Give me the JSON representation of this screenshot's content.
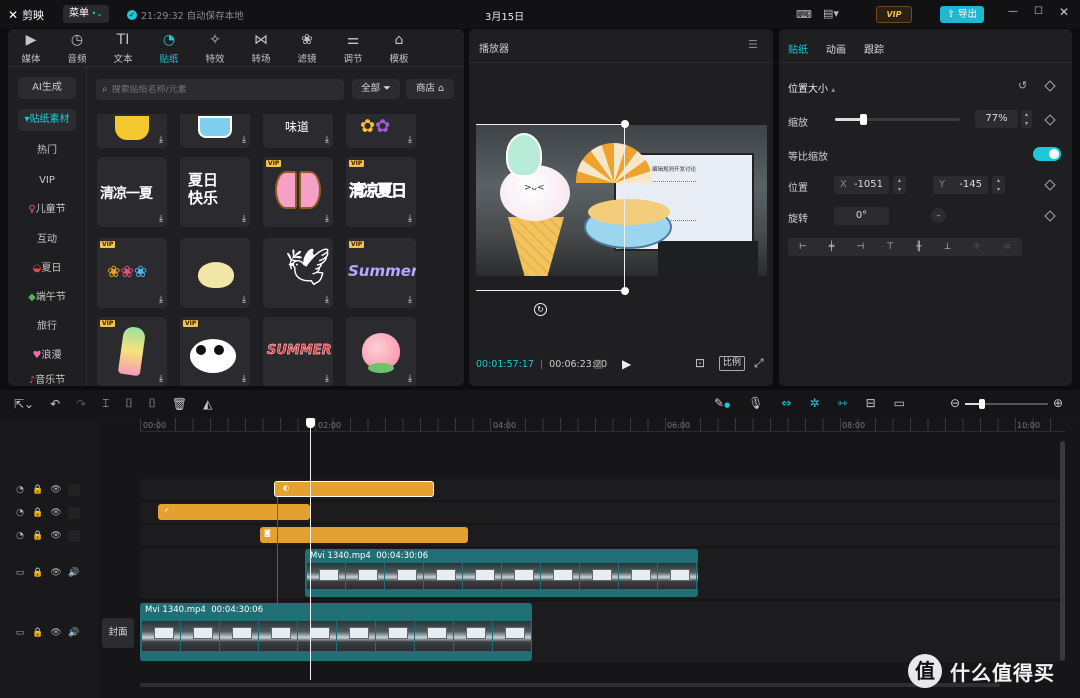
{
  "app": {
    "name": "剪映",
    "menu_label": "菜单",
    "autosave_text": "21:29:32 自动保存本地",
    "project_title": "3月15日",
    "vip_label": "VIP",
    "export_label": "导出"
  },
  "media_tabs": [
    {
      "label": "媒体",
      "icon": "media-icon"
    },
    {
      "label": "音频",
      "icon": "audio-icon"
    },
    {
      "label": "文本",
      "icon": "text-icon"
    },
    {
      "label": "贴纸",
      "icon": "sticker-icon"
    },
    {
      "label": "特效",
      "icon": "effects-icon"
    },
    {
      "label": "转场",
      "icon": "transition-icon"
    },
    {
      "label": "滤镜",
      "icon": "filter-icon"
    },
    {
      "label": "调节",
      "icon": "adjust-icon"
    },
    {
      "label": "模板",
      "icon": "template-icon"
    }
  ],
  "sidebar": {
    "ai_label": "AI生成",
    "active_label": "贴纸素材",
    "items": [
      "热门",
      "VIP",
      "儿童节",
      "互动",
      "夏日",
      "端午节",
      "旅行",
      "浪漫",
      "音乐节"
    ]
  },
  "search": {
    "placeholder": "搜索贴纸名称/元素",
    "filter_label": "全部",
    "store_label": "商店"
  },
  "stickers": [
    {
      "name": "sticker-cup",
      "text": ""
    },
    {
      "name": "sticker-ice",
      "text": ""
    },
    {
      "name": "sticker-weidao",
      "text": "味道"
    },
    {
      "name": "sticker-flowers",
      "text": ""
    },
    {
      "name": "sticker-qingliang-yixia",
      "text": "清凉一夏"
    },
    {
      "name": "sticker-xiari-kuaile",
      "text": "夏日快乐"
    },
    {
      "name": "sticker-butterfly",
      "text": ""
    },
    {
      "name": "sticker-qingliang-xiari",
      "text": "清凉夏日"
    },
    {
      "name": "sticker-tulips",
      "text": ""
    },
    {
      "name": "sticker-bird",
      "text": ""
    },
    {
      "name": "sticker-dove",
      "text": ""
    },
    {
      "name": "sticker-summer",
      "text": "Summer"
    },
    {
      "name": "sticker-popsicle",
      "text": ""
    },
    {
      "name": "sticker-panda",
      "text": ""
    },
    {
      "name": "sticker-summer-red",
      "text": "SUMMER"
    },
    {
      "name": "sticker-peach",
      "text": ""
    }
  ],
  "player": {
    "title": "播放器",
    "current_time": "00:01:57:17",
    "total_time": "00:06:23:20",
    "ratio_label": "比例",
    "slide_text": "编辑规则开发讨论"
  },
  "inspector": {
    "tabs": [
      "贴纸",
      "动画",
      "跟踪"
    ],
    "section_title": "位置大小",
    "scale_label": "缩放",
    "scale_value": "77%",
    "scale_fraction": 0.22,
    "uniform_label": "等比缩放",
    "position_label": "位置",
    "x_label": "X",
    "x_value": "-1051",
    "y_label": "Y",
    "y_value": "-145",
    "rotation_label": "旋转",
    "rotation_value": "0°"
  },
  "timeline": {
    "ruler": [
      "00:00",
      "02:00",
      "04:00",
      "06:00",
      "08:00",
      "10:00"
    ],
    "tracks": [
      {
        "type": "sticker",
        "label": ""
      },
      {
        "type": "sticker",
        "label": ""
      },
      {
        "type": "sticker",
        "label": ""
      },
      {
        "type": "video",
        "label": "Mvi 1340.mp4  00:04:30:06"
      },
      {
        "type": "main",
        "label": "Mvi 1340.mp4  00:04:30:06",
        "cover_label": "封面"
      }
    ]
  },
  "colors": {
    "accent": "#1fc8d8",
    "sticker_clip": "#e5a12f",
    "video_clip": "#1f6f74",
    "vip_gold": "#f4c04e"
  },
  "watermark": "什么值得买"
}
